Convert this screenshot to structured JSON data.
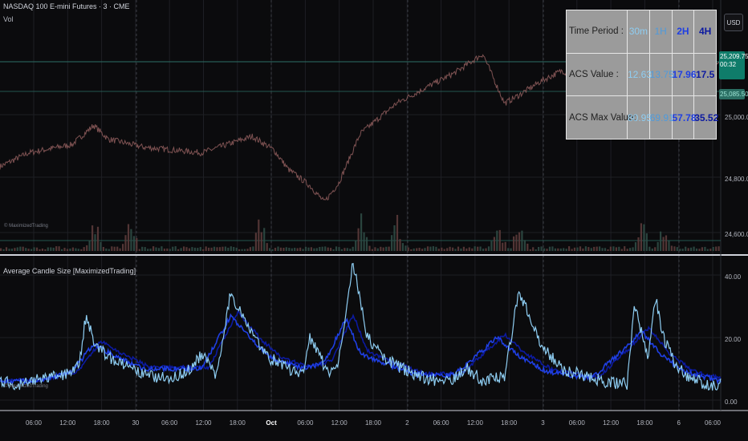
{
  "header": {
    "symbol_title": "NASDAQ 100 E-mini Futures · 3 · CME",
    "volume_label": "Vol",
    "watermark": "© MaximizedTrading",
    "currency_button": "USD"
  },
  "price_panel": {
    "current_price": "25,209.75",
    "countdown": "00:32",
    "previous_tag": "25,085.50",
    "y_axis": [
      "25,000.00",
      "24,800.00",
      "24,600.00"
    ]
  },
  "indicator": {
    "title": "Average Candle Size [MaximizedTrading]",
    "watermark": "© MaximizedTrading",
    "y_axis": [
      "40.00",
      "20.00",
      "0.00"
    ]
  },
  "x_axis": {
    "labels": [
      "06:00",
      "12:00",
      "18:00",
      "30",
      "06:00",
      "12:00",
      "18:00",
      "Oct",
      "06:00",
      "12:00",
      "18:00",
      "2",
      "06:00",
      "12:00",
      "18:00",
      "3",
      "06:00",
      "12:00",
      "18:00",
      "6",
      "06:00"
    ]
  },
  "acs_table": {
    "headers": [
      "Time Period :",
      "30m",
      "1H",
      "2H",
      "4H"
    ],
    "rows": [
      {
        "label": "ACS Value    :",
        "values": [
          "12.63",
          "13.75",
          "17.96",
          "17.5"
        ]
      },
      {
        "label": "ACS Max Value:",
        "values": [
          "80.95",
          "69.91",
          "57.78",
          "35.52"
        ]
      }
    ]
  },
  "chart_data": [
    {
      "type": "line",
      "title": "NASDAQ 100 E-mini Futures · 3 · CME",
      "ylim": [
        24560,
        25320
      ],
      "series": [
        {
          "name": "",
          "x": [
            0,
            0.04,
            0.1,
            0.13,
            0.15,
            0.2,
            0.28,
            0.35,
            0.38,
            0.4,
            0.43,
            0.45,
            0.47,
            0.5,
            0.55,
            0.6,
            0.63,
            0.67,
            0.69,
            0.7,
            0.72,
            0.75,
            0.78,
            0.8,
            0.84,
            0.87,
            0.9,
            0.93,
            0.96,
            1.0
          ],
          "values": [
            24830,
            24880,
            24910,
            24980,
            24930,
            24900,
            24880,
            24940,
            24890,
            24820,
            24760,
            24700,
            24770,
            24950,
            25060,
            25130,
            25170,
            25240,
            25120,
            25060,
            25090,
            25140,
            25180,
            25150,
            25160,
            25120,
            25150,
            25190,
            25160,
            25210
          ]
        }
      ]
    },
    {
      "type": "line",
      "title": "Average Candle Size [MaximizedTrading]",
      "ylim": [
        0,
        45
      ],
      "series": [
        {
          "name": "",
          "x": [
            0,
            0.03,
            0.06,
            0.09,
            0.11,
            0.12,
            0.13,
            0.15,
            0.18,
            0.2,
            0.23,
            0.26,
            0.28,
            0.29,
            0.3,
            0.32,
            0.35,
            0.37,
            0.4,
            0.42,
            0.43,
            0.45,
            0.46,
            0.47,
            0.49,
            0.51,
            0.53,
            0.56,
            0.59,
            0.62,
            0.65,
            0.67,
            0.69,
            0.7,
            0.72,
            0.75,
            0.78,
            0.81,
            0.84,
            0.87,
            0.88,
            0.9,
            0.91,
            0.92,
            0.94,
            0.96,
            0.98,
            1.0
          ],
          "values": [
            6,
            5,
            7,
            8,
            12,
            28,
            18,
            14,
            10,
            8,
            7,
            9,
            15,
            11,
            8,
            34,
            22,
            14,
            10,
            8,
            20,
            11,
            9,
            12,
            44,
            20,
            14,
            10,
            7,
            6,
            10,
            6,
            7,
            8,
            35,
            18,
            10,
            8,
            6,
            5,
            30,
            14,
            33,
            20,
            10,
            7,
            5,
            5
          ]
        },
        {
          "name": "",
          "x": [
            0,
            0.05,
            0.1,
            0.13,
            0.16,
            0.2,
            0.28,
            0.32,
            0.35,
            0.38,
            0.42,
            0.45,
            0.48,
            0.5,
            0.53,
            0.58,
            0.63,
            0.69,
            0.72,
            0.76,
            0.82,
            0.86,
            0.89,
            0.92,
            0.95,
            1.0
          ],
          "values": [
            6,
            6,
            9,
            18,
            14,
            10,
            10,
            27,
            19,
            13,
            10,
            12,
            26,
            15,
            12,
            8,
            8,
            20,
            14,
            9,
            7,
            15,
            22,
            14,
            9,
            6
          ]
        }
      ]
    }
  ]
}
